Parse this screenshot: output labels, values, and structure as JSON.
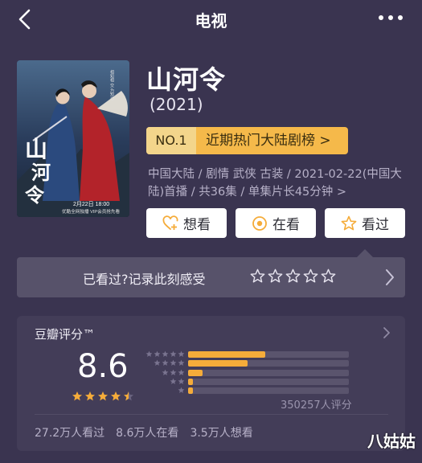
{
  "nav": {
    "title": "电视",
    "back_icon": "chevron-left-icon",
    "more_icon": "more-dots-icon"
  },
  "poster": {
    "title_art": "山河令",
    "side_text": "相知相 交 为知己",
    "date_text": "2月22日 18:00",
    "promo_text": "优酷全网独播 VIP会员抢先看"
  },
  "show": {
    "title": "山河令",
    "year": "(2021)"
  },
  "rank": {
    "no": "NO.1",
    "label": "近期热门大陆剧榜 >"
  },
  "meta": {
    "text": "中国大陆 / 剧情 武侠 古装 / 2021-02-22(中国大陆)首播 / 共36集 / 单集片长45分钟 >"
  },
  "actions": {
    "want": "想看",
    "watching": "在看",
    "watched": "看过"
  },
  "record": {
    "prompt": "已看过?记录此刻感受"
  },
  "rating": {
    "label": "豆瓣评分™",
    "score": "8.6",
    "stars": 4.5,
    "distribution_pct": [
      48,
      37,
      9,
      3,
      3
    ],
    "count": "350257人评分"
  },
  "stats": {
    "watched": "27.2万人看过",
    "watching": "8.6万人在看",
    "want": "3.5万人想看"
  },
  "watermark": "八姑姑",
  "colors": {
    "background": "#3a3450",
    "accent": "#f5ac3a",
    "badge": "#f5b94a"
  }
}
